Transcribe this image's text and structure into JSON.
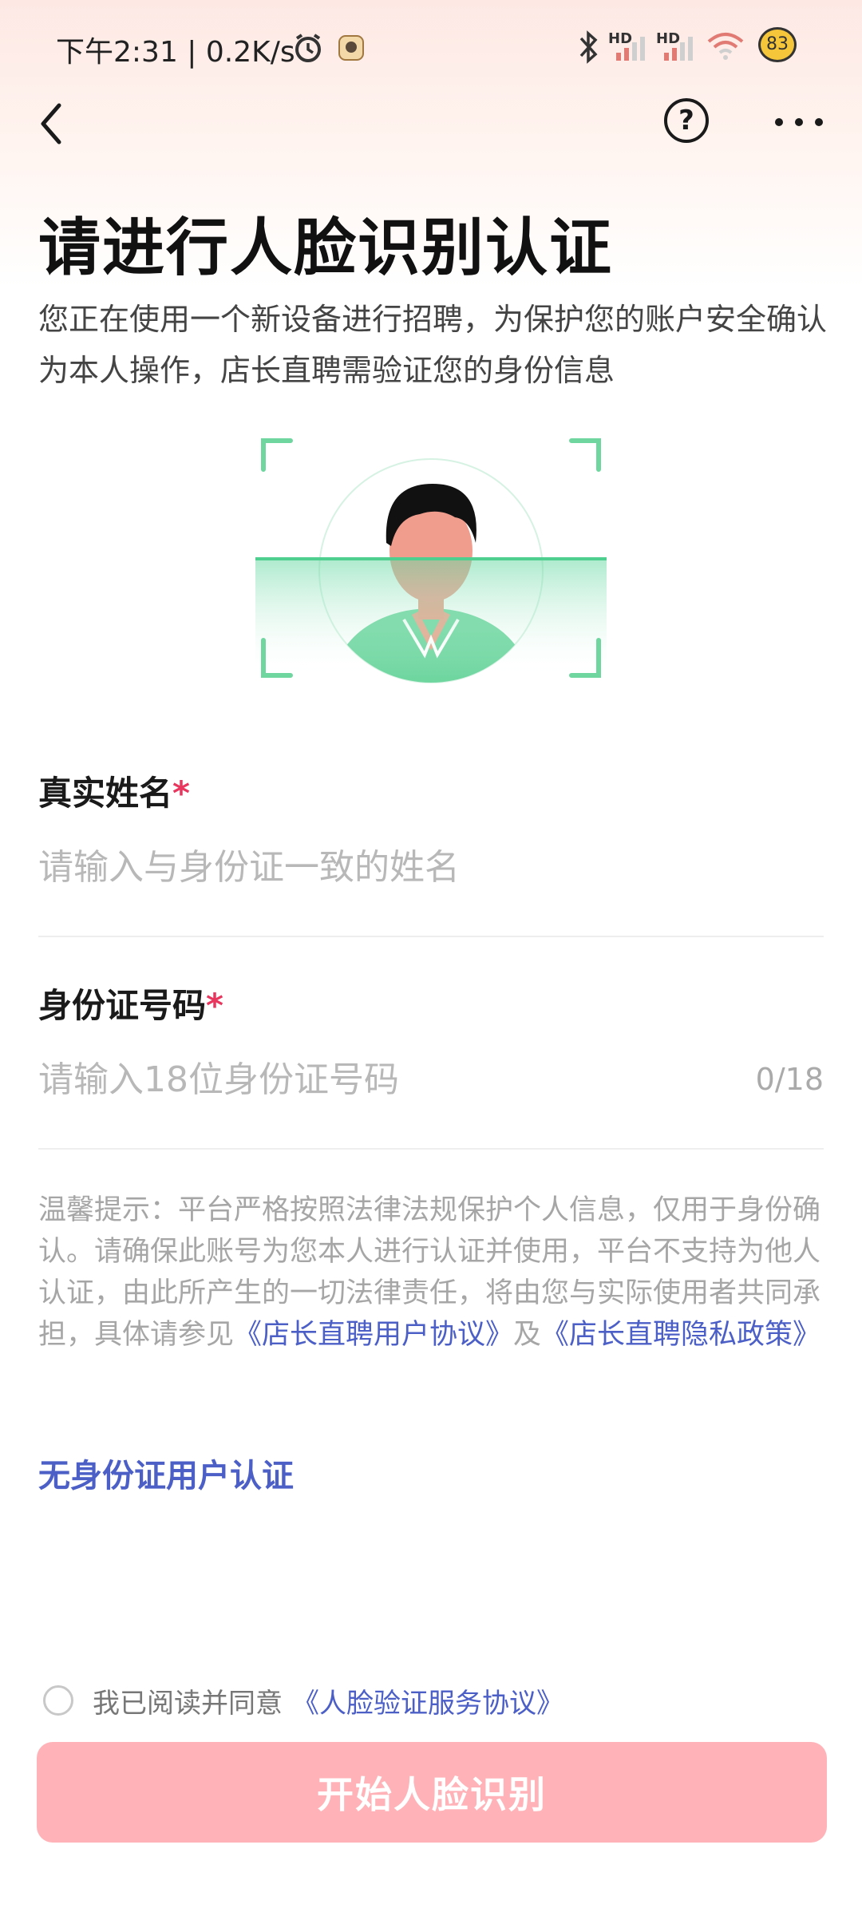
{
  "status_bar": {
    "time": "下午2:31 | 0.2K/s",
    "network_label_1": "HD",
    "network_label_2": "HD",
    "battery": "83"
  },
  "header": {
    "title": "请进行人脸识别认证",
    "subtitle": "您正在使用一个新设备进行招聘，为保护您的账户安全确认为本人操作，店长直聘需验证您的身份信息"
  },
  "form": {
    "name_label": "真实姓名",
    "name_placeholder": "请输入与身份证一致的姓名",
    "name_value": "",
    "id_label": "身份证号码",
    "id_placeholder": "请输入18位身份证号码",
    "id_value": "",
    "id_counter": "0/18",
    "required_mark": "*"
  },
  "tip": {
    "text": "温馨提示：平台严格按照法律法规保护个人信息，仅用于身份确认。请确保此账号为您本人进行认证并使用，平台不支持为他人认证，由此所产生的一切法律责任，将由您与实际使用者共同承担，具体请参见",
    "link_user_agreement": "《店长直聘用户协议》",
    "and": "及",
    "link_privacy": "《店长直聘隐私政策》"
  },
  "no_id_link": "无身份证用户认证",
  "agreement": {
    "text": "我已阅读并同意",
    "link": "《人脸验证服务协议》",
    "checked": false
  },
  "start_button": "开始人脸识别",
  "colors": {
    "accent_link": "#4b5fc7",
    "required": "#e8365e",
    "button_disabled": "#ffb3b8",
    "scan_green": "#5fd39a"
  }
}
